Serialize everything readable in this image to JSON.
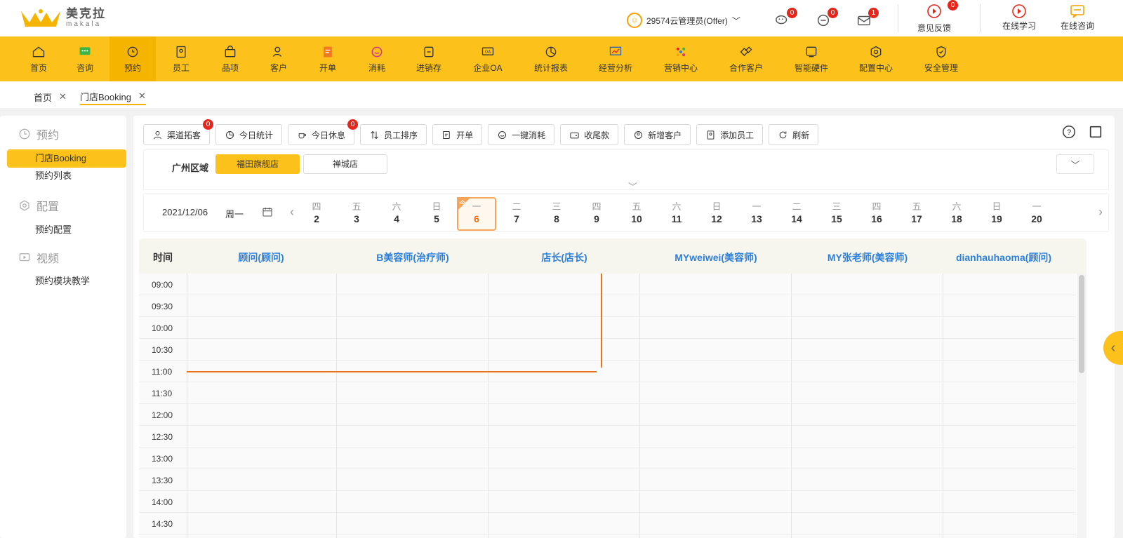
{
  "header": {
    "logo_cn": "美克拉",
    "logo_en": "makala",
    "user_label": "29574云管理员(Offer)",
    "wechat_badge": "0",
    "message_badge": "0",
    "mail_badge": "1",
    "feedback_label": "意见反馈",
    "feedback_badge": "0",
    "learning_label": "在线学习",
    "consult_label": "在线咨询"
  },
  "nav": [
    {
      "label": "首页",
      "icon": "home-icon"
    },
    {
      "label": "咨询",
      "icon": "consult-icon"
    },
    {
      "label": "预约",
      "icon": "clock-icon"
    },
    {
      "label": "员工",
      "icon": "badge-icon"
    },
    {
      "label": "品项",
      "icon": "bag-icon"
    },
    {
      "label": "客户",
      "icon": "customer-icon"
    },
    {
      "label": "开单",
      "icon": "order-icon"
    },
    {
      "label": "消耗",
      "icon": "consume-icon"
    },
    {
      "label": "进销存",
      "icon": "inventory-icon"
    },
    {
      "label": "企业OA",
      "icon": "oa-icon"
    },
    {
      "label": "统计报表",
      "icon": "report-icon"
    },
    {
      "label": "经营分析",
      "icon": "analysis-icon"
    },
    {
      "label": "营销中心",
      "icon": "marketing-icon"
    },
    {
      "label": "合作客户",
      "icon": "partner-icon"
    },
    {
      "label": "智能硬件",
      "icon": "hardware-icon"
    },
    {
      "label": "配置中心",
      "icon": "config-icon"
    },
    {
      "label": "安全管理",
      "icon": "shield-icon"
    }
  ],
  "tabs": [
    {
      "label": "首页"
    },
    {
      "label": "门店Booking"
    }
  ],
  "sidebar": {
    "groups": [
      {
        "title": "预约",
        "items": [
          "门店Booking",
          "预约列表"
        ]
      },
      {
        "title": "配置",
        "items": [
          "预约配置"
        ]
      },
      {
        "title": "视频",
        "items": [
          "预约模块教学"
        ]
      }
    ]
  },
  "toolbar": {
    "buttons": [
      "渠道拓客",
      "今日统计",
      "今日休息",
      "员工排序",
      "开单",
      "一键消耗",
      "收尾款",
      "新增客户",
      "添加员工",
      "刷新"
    ],
    "channel_badge": "0",
    "rest_badge": "0"
  },
  "stores": {
    "region": "广州区域",
    "items": [
      "福田旗舰店",
      "禅城店"
    ]
  },
  "date_bar": {
    "date": "2021/12/06",
    "weekday": "周一",
    "today_mark": "今",
    "days": [
      {
        "wd": "四",
        "d": "2"
      },
      {
        "wd": "五",
        "d": "3"
      },
      {
        "wd": "六",
        "d": "4"
      },
      {
        "wd": "日",
        "d": "5"
      },
      {
        "wd": "一",
        "d": "6"
      },
      {
        "wd": "二",
        "d": "7"
      },
      {
        "wd": "三",
        "d": "8"
      },
      {
        "wd": "四",
        "d": "9"
      },
      {
        "wd": "五",
        "d": "10"
      },
      {
        "wd": "六",
        "d": "11"
      },
      {
        "wd": "日",
        "d": "12"
      },
      {
        "wd": "一",
        "d": "13"
      },
      {
        "wd": "二",
        "d": "14"
      },
      {
        "wd": "三",
        "d": "15"
      },
      {
        "wd": "四",
        "d": "16"
      },
      {
        "wd": "五",
        "d": "17"
      },
      {
        "wd": "六",
        "d": "18"
      },
      {
        "wd": "日",
        "d": "19"
      },
      {
        "wd": "一",
        "d": "20"
      }
    ]
  },
  "schedule": {
    "time_header": "时间",
    "staff": [
      "顾问(顾问)",
      "B美容师(治疗师)",
      "店长(店长)",
      "MYweiwei(美容师)",
      "MY张老师(美容师)",
      "dianhauhaoma(顾问)"
    ],
    "times": [
      "09:00",
      "09:30",
      "10:00",
      "10:30",
      "11:00",
      "11:30",
      "12:00",
      "12:30",
      "13:00",
      "13:30",
      "14:00",
      "14:30"
    ]
  },
  "colors": {
    "brand": "#fcc21b",
    "staff_text": "#2f7fd8",
    "now_line": "#e8731a",
    "badge": "#e8251a"
  }
}
